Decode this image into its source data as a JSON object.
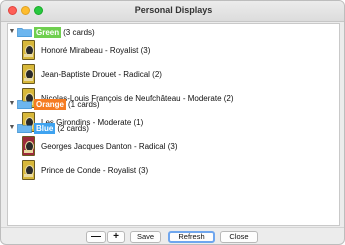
{
  "window": {
    "title": "Personal Displays"
  },
  "colors": {
    "green": "#6fcf4f",
    "orange": "#f57c22",
    "blue": "#3fa3f0",
    "card_yellow": "#d8b83a",
    "card_red": "#9c2a3a"
  },
  "groups": [
    {
      "label": "Green",
      "count_text": "(3 cards)",
      "cards": [
        {
          "label": "Honoré Mirabeau - Royalist (3)",
          "color": "yellow"
        },
        {
          "label": "Jean-Baptiste Drouet - Radical (2)",
          "color": "yellow"
        },
        {
          "label": "Nicolas-Louis François de Neufchâteau - Moderate (2)",
          "color": "yellow"
        }
      ]
    },
    {
      "label": "Orange",
      "count_text": "(1 cards)",
      "cards": [
        {
          "label": "Les Girondins - Moderate (1)",
          "color": "yellow"
        }
      ]
    },
    {
      "label": "Blue",
      "count_text": "(2 cards)",
      "cards": [
        {
          "label": "Georges Jacques Danton - Radical (3)",
          "color": "red"
        },
        {
          "label": "Prince de Conde - Royalist (3)",
          "color": "yellow"
        }
      ]
    }
  ],
  "toolbar": {
    "minus": "—",
    "plus": "+",
    "save": "Save",
    "refresh": "Refresh",
    "close": "Close"
  },
  "icons": {
    "collapse": "▼",
    "folder": "folder-icon"
  }
}
